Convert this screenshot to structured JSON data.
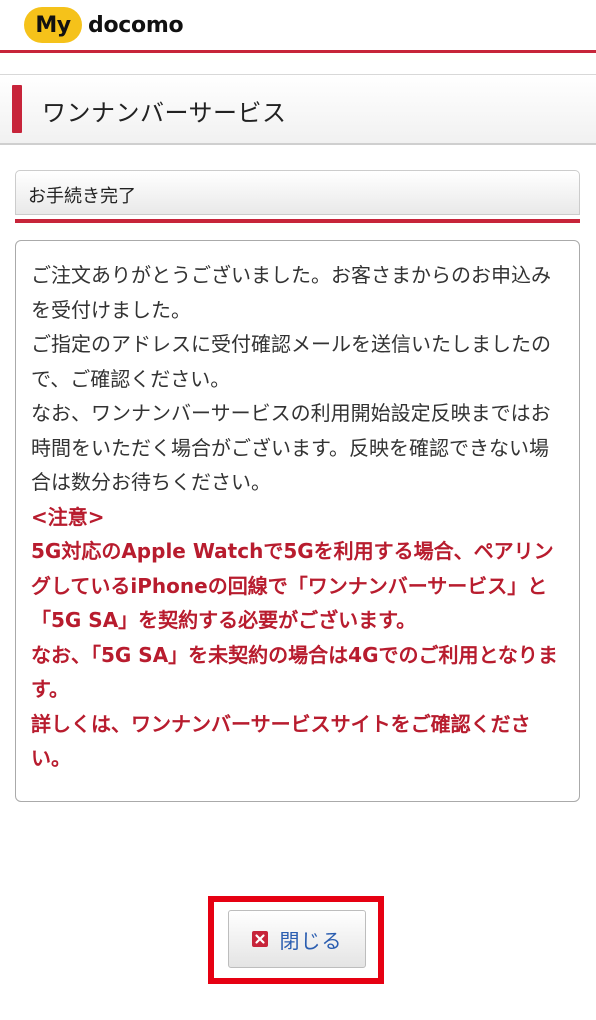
{
  "header": {
    "logo_badge": "My",
    "logo_text": "docomo"
  },
  "page": {
    "title": "ワンナンバーサービス"
  },
  "section": {
    "title": "お手続き完了"
  },
  "message": {
    "paragraphs": [
      "ご注文ありがとうございました。お客さまからのお申込みを受付けました。",
      "ご指定のアドレスに受付確認メールを送信いたしましたので、ご確認ください。",
      "なお、ワンナンバーサービスの利用開始設定反映まではお時間をいただく場合がございます。反映を確認できない場合は数分お待ちください。"
    ],
    "notice_title": "<注意>",
    "notice_paragraphs": [
      "5G対応のApple Watchで5Gを利用する場合、ペアリングしているiPhoneの回線で「ワンナンバーサービス」と「5G SA」を契約する必要がございます。",
      "なお、「5G SA」を未契約の場合は4Gでのご利用となります。",
      "詳しくは、ワンナンバーサービスサイトをご確認ください。"
    ]
  },
  "actions": {
    "close_label": "閉じる"
  },
  "colors": {
    "brand_red": "#c7243a",
    "notice_red": "#b81c2e",
    "logo_yellow": "#f5c21a",
    "link_blue": "#2a5db0",
    "highlight_frame": "#e60012"
  },
  "icons": {
    "close": "close-x-icon"
  }
}
